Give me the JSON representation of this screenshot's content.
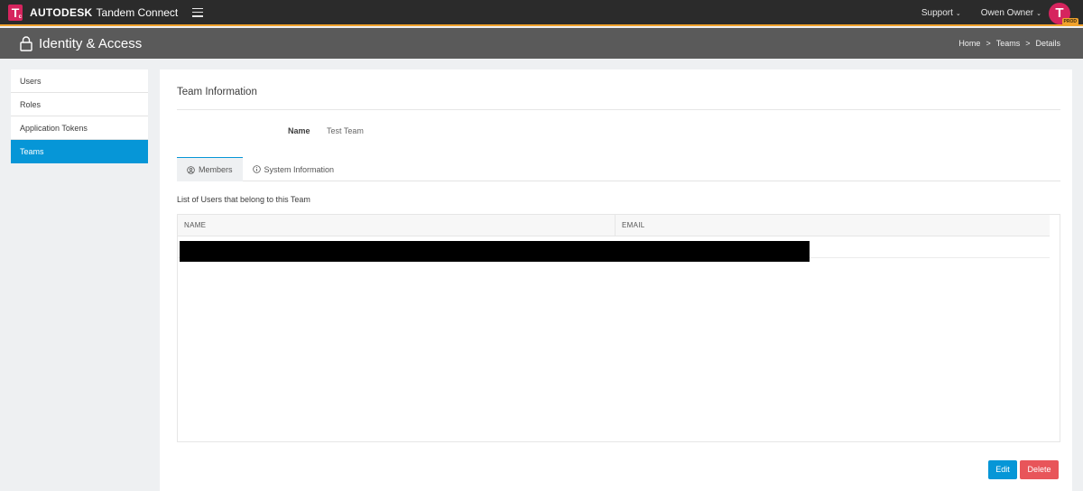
{
  "topbar": {
    "logo_letter": "T",
    "logo_sub": "c",
    "brand_strong": "AUTODESK",
    "brand_product": "Tandem Connect",
    "support_label": "Support",
    "user_label": "Owen Owner",
    "avatar_letter": "T",
    "env_badge": "PROD"
  },
  "page_header": {
    "title": "Identity & Access",
    "breadcrumb": [
      "Home",
      "Teams",
      "Details"
    ],
    "separator": ">"
  },
  "sidebar": {
    "items": [
      {
        "label": "Users",
        "active": false
      },
      {
        "label": "Roles",
        "active": false
      },
      {
        "label": "Application Tokens",
        "active": false
      },
      {
        "label": "Teams",
        "active": true
      }
    ]
  },
  "main": {
    "section_title": "Team Information",
    "fields": [
      {
        "label": "Name",
        "value": "Test Team"
      }
    ],
    "tabs": [
      {
        "label": "Members",
        "icon": "user-circle-icon",
        "active": true
      },
      {
        "label": "System Information",
        "icon": "info-icon",
        "active": false
      }
    ],
    "list_caption": "List of Users that belong to this Team",
    "table": {
      "columns": [
        "NAME",
        "EMAIL"
      ],
      "rows_redacted": 1
    },
    "actions": {
      "edit_label": "Edit",
      "delete_label": "Delete"
    }
  },
  "colors": {
    "accent": "#0696d7",
    "danger": "#e8555a",
    "brand": "#d6245e",
    "topbar_border": "#f1a22c"
  }
}
